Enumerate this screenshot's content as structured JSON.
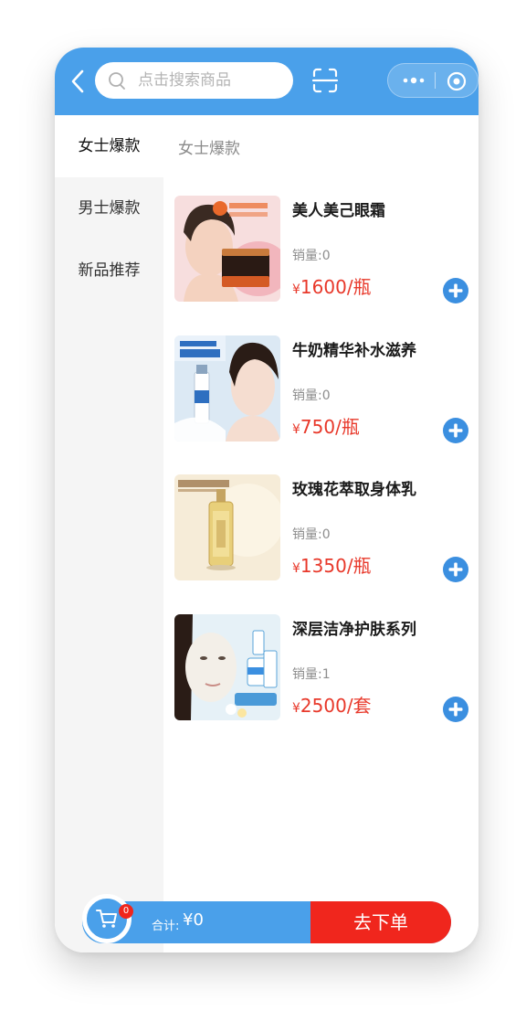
{
  "header": {
    "search_placeholder": "点击搜索商品"
  },
  "sidebar": {
    "items": [
      {
        "label": "女士爆款",
        "active": true
      },
      {
        "label": "男士爆款",
        "active": false
      },
      {
        "label": "新品推荐",
        "active": false
      }
    ]
  },
  "main": {
    "category_title": "女士爆款",
    "products": [
      {
        "name": "美人美己眼霜",
        "sales": "销量:0",
        "currency": "¥",
        "price": "1600/瓶",
        "image": "eye-cream-model-image"
      },
      {
        "name": "牛奶精华补水滋养",
        "sales": "销量:0",
        "currency": "¥",
        "price": "750/瓶",
        "image": "milk-serum-model-image"
      },
      {
        "name": "玫瑰花萃取身体乳",
        "sales": "销量:0",
        "currency": "¥",
        "price": "1350/瓶",
        "image": "rose-body-lotion-image"
      },
      {
        "name": "深层洁净护肤系列",
        "sales": "销量:1",
        "currency": "¥",
        "price": "2500/套",
        "image": "face-mask-model-image"
      }
    ]
  },
  "cart": {
    "badge_count": "0",
    "total_label": "合计:",
    "total_value": "¥0",
    "checkout_label": "去下单"
  },
  "colors": {
    "primary_blue": "#4aa0ea",
    "price_red": "#e8382a",
    "checkout_red": "#f0261d"
  }
}
